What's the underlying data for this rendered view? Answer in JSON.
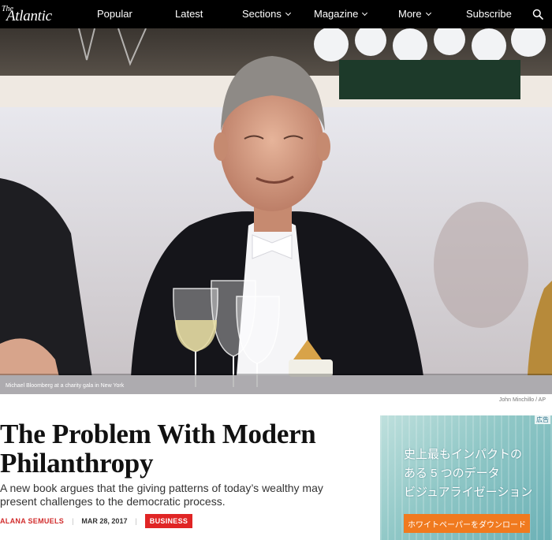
{
  "nav": {
    "logo_the": "The",
    "logo_name": "Atlantic",
    "items": [
      {
        "label": "Popular"
      },
      {
        "label": "Latest"
      },
      {
        "label": "Sections"
      },
      {
        "label": "Magazine"
      },
      {
        "label": "More"
      },
      {
        "label": "Subscribe"
      }
    ],
    "search_icon": "search-icon"
  },
  "hero": {
    "caption": "Michael Bloomberg at a charity gala in New York",
    "credit": "John Minchillo / AP"
  },
  "article": {
    "title": "The Problem With Modern Philanthropy",
    "dek": "A new book argues that the giving patterns of today’s wealthy may present challenges to the democratic process.",
    "author": "ALANA SEMUELS",
    "date": "MAR 28, 2017",
    "section_tag": "BUSINESS"
  },
  "ad": {
    "badge": "広告",
    "lines": [
      "史上最もインパクトの",
      "ある 5 つのデータ",
      "ビジュアライゼーション"
    ],
    "cta": "ホワイトペーパーをダウンロード"
  },
  "colors": {
    "nav_bg": "#000000",
    "accent_red": "#e02525",
    "ad_button": "#f07a1f"
  }
}
